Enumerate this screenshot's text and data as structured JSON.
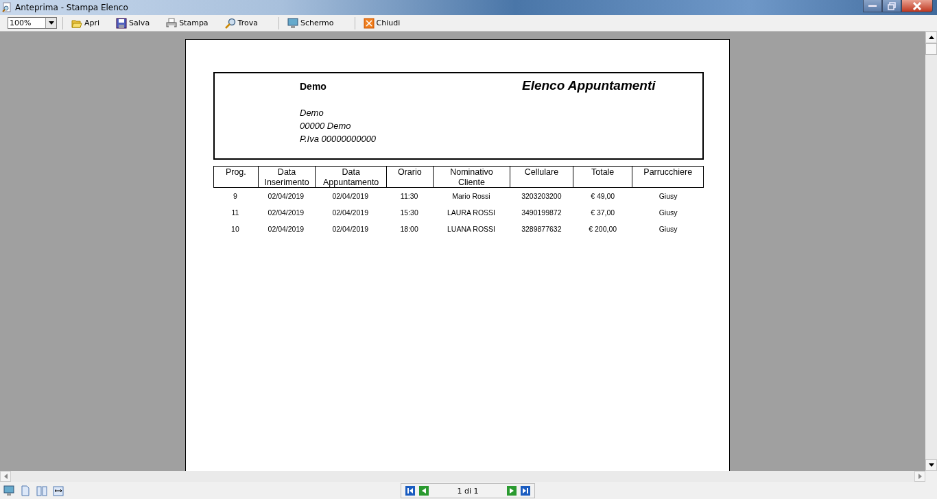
{
  "window": {
    "title": "Anteprima - Stampa Elenco"
  },
  "toolbar": {
    "zoom": "100%",
    "buttons": [
      {
        "kind": "open",
        "label": "Apri"
      },
      {
        "kind": "save",
        "label": "Salva"
      },
      {
        "kind": "print",
        "label": "Stampa"
      },
      {
        "kind": "find",
        "label": "Trova"
      },
      {
        "kind": "screen",
        "label": "Schermo",
        "separator_before": true
      },
      {
        "kind": "close",
        "label": "Chiudi",
        "separator_before": true
      }
    ]
  },
  "report": {
    "company": "Demo",
    "title": "Elenco Appuntamenti",
    "address_lines": [
      "Demo",
      "00000   Demo",
      "P.Iva 00000000000"
    ],
    "columns": [
      "Prog.",
      "Data\nInserimento",
      "Data\nAppuntamento",
      "Orario",
      "Nominativo\nCliente",
      "Cellulare",
      "Totale",
      "Parrucchiere"
    ],
    "rows": [
      [
        "9",
        "02/04/2019",
        "02/04/2019",
        "11:30",
        "Mario Rossi",
        "3203203200",
        "€ 49,00",
        "Giusy"
      ],
      [
        "11",
        "02/04/2019",
        "02/04/2019",
        "15:30",
        "LAURA ROSSI",
        "3490199872",
        "€ 37,00",
        "Giusy"
      ],
      [
        "10",
        "02/04/2019",
        "02/04/2019",
        "18:00",
        "LUANA ROSSI",
        "3289877632",
        "€ 200,00",
        "Giusy"
      ]
    ]
  },
  "pager": {
    "text": "1 di 1"
  }
}
